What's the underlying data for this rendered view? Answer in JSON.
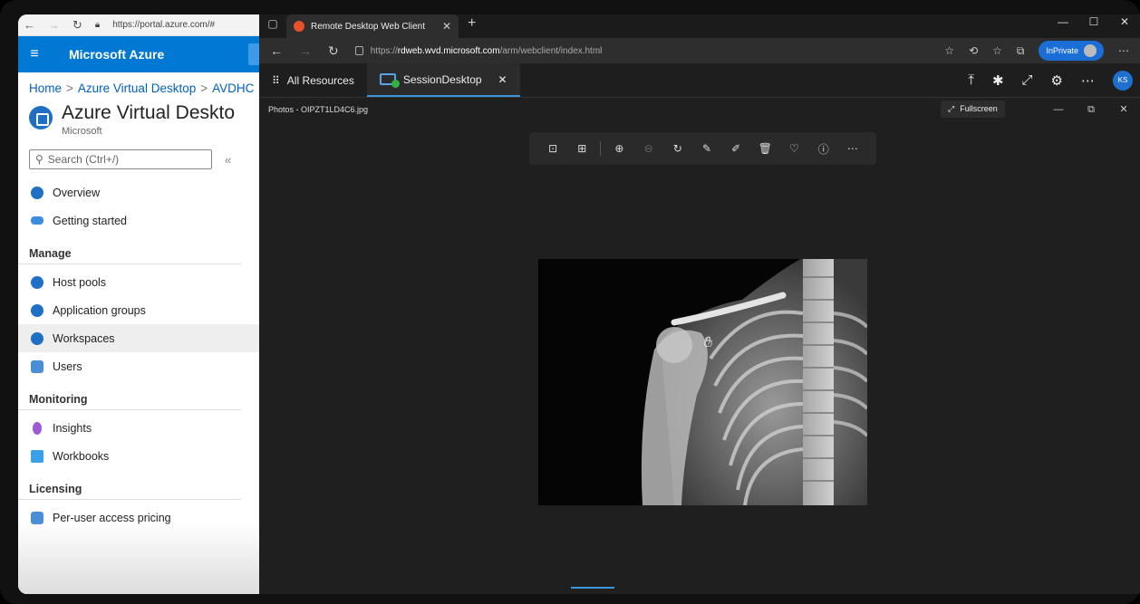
{
  "azure": {
    "browser_url": "https://portal.azure.com/#",
    "header_title": "Microsoft Azure",
    "breadcrumb": [
      "Home",
      "Azure Virtual Desktop",
      "AVDHC"
    ],
    "page_title": "Azure Virtual Deskto",
    "page_subtitle": "Microsoft",
    "search_placeholder": "Search (Ctrl+/)",
    "collapse": "«",
    "items_top": [
      {
        "label": "Overview",
        "color": "#1f6fc4"
      },
      {
        "label": "Getting started",
        "color": "#3c8ce0"
      }
    ],
    "section_manage": "Manage",
    "items_manage": [
      {
        "label": "Host pools",
        "color": "#1f6fc4"
      },
      {
        "label": "Application groups",
        "color": "#1f6fc4"
      },
      {
        "label": "Workspaces",
        "color": "#1f6fc4"
      },
      {
        "label": "Users",
        "color": "#4a8fd6"
      }
    ],
    "section_monitoring": "Monitoring",
    "items_monitoring": [
      {
        "label": "Insights",
        "color": "#9b5ad6"
      },
      {
        "label": "Workbooks",
        "color": "#3aa0e8"
      }
    ],
    "section_licensing": "Licensing",
    "items_licensing": [
      {
        "label": "Per-user access pricing",
        "color": "#4a8fd6"
      }
    ]
  },
  "edge": {
    "tab_title": "Remote Desktop Web Client",
    "url_prefix": "https://",
    "url_host": "rdweb.wvd.microsoft.com",
    "url_path": "/arm/webclient/index.html",
    "inprivate": "InPrivate"
  },
  "rd": {
    "all_resources": "All Resources",
    "session_tab": "SessionDesktop",
    "avatar_initials": "KS"
  },
  "photos": {
    "window_title": "Photos - OIPZT1LD4C6.jpg",
    "fullscreen": "Fullscreen"
  }
}
